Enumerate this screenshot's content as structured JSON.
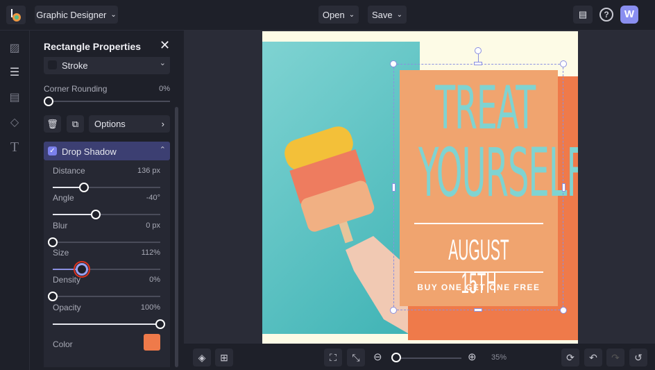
{
  "header": {
    "workspace": "Graphic Designer",
    "open": "Open",
    "save": "Save",
    "avatar": "W"
  },
  "panel": {
    "title": "Rectangle Properties",
    "stroke": "Stroke",
    "corner_label": "Corner Rounding",
    "corner_value": "0%",
    "corner_fraction": 0,
    "options": "Options",
    "drop_shadow": "Drop Shadow",
    "sliders": [
      {
        "label": "Distance",
        "value": "136 px",
        "fraction": 0.29
      },
      {
        "label": "Angle",
        "value": "-40°",
        "fraction": 0.4
      },
      {
        "label": "Blur",
        "value": "0 px",
        "fraction": 0
      },
      {
        "label": "Size",
        "value": "112%",
        "fraction": 0.26
      },
      {
        "label": "Density",
        "value": "0%",
        "fraction": 0
      },
      {
        "label": "Opacity",
        "value": "100%",
        "fraction": 1
      }
    ],
    "color_label": "Color",
    "color": "#ef7a4a"
  },
  "poster": {
    "line1": "TREAT",
    "line2": "YOURSELF",
    "date": "AUGUST 15TH",
    "offer": "BUY ONE GET ONE FREE"
  },
  "zoom": {
    "value": "35%"
  },
  "colors": {
    "accent": "#6b6fd6",
    "teal": "#5bc4c3",
    "peach": "#f0a46f",
    "orange": "#ef7a4a",
    "cream": "#fdfbe6"
  }
}
